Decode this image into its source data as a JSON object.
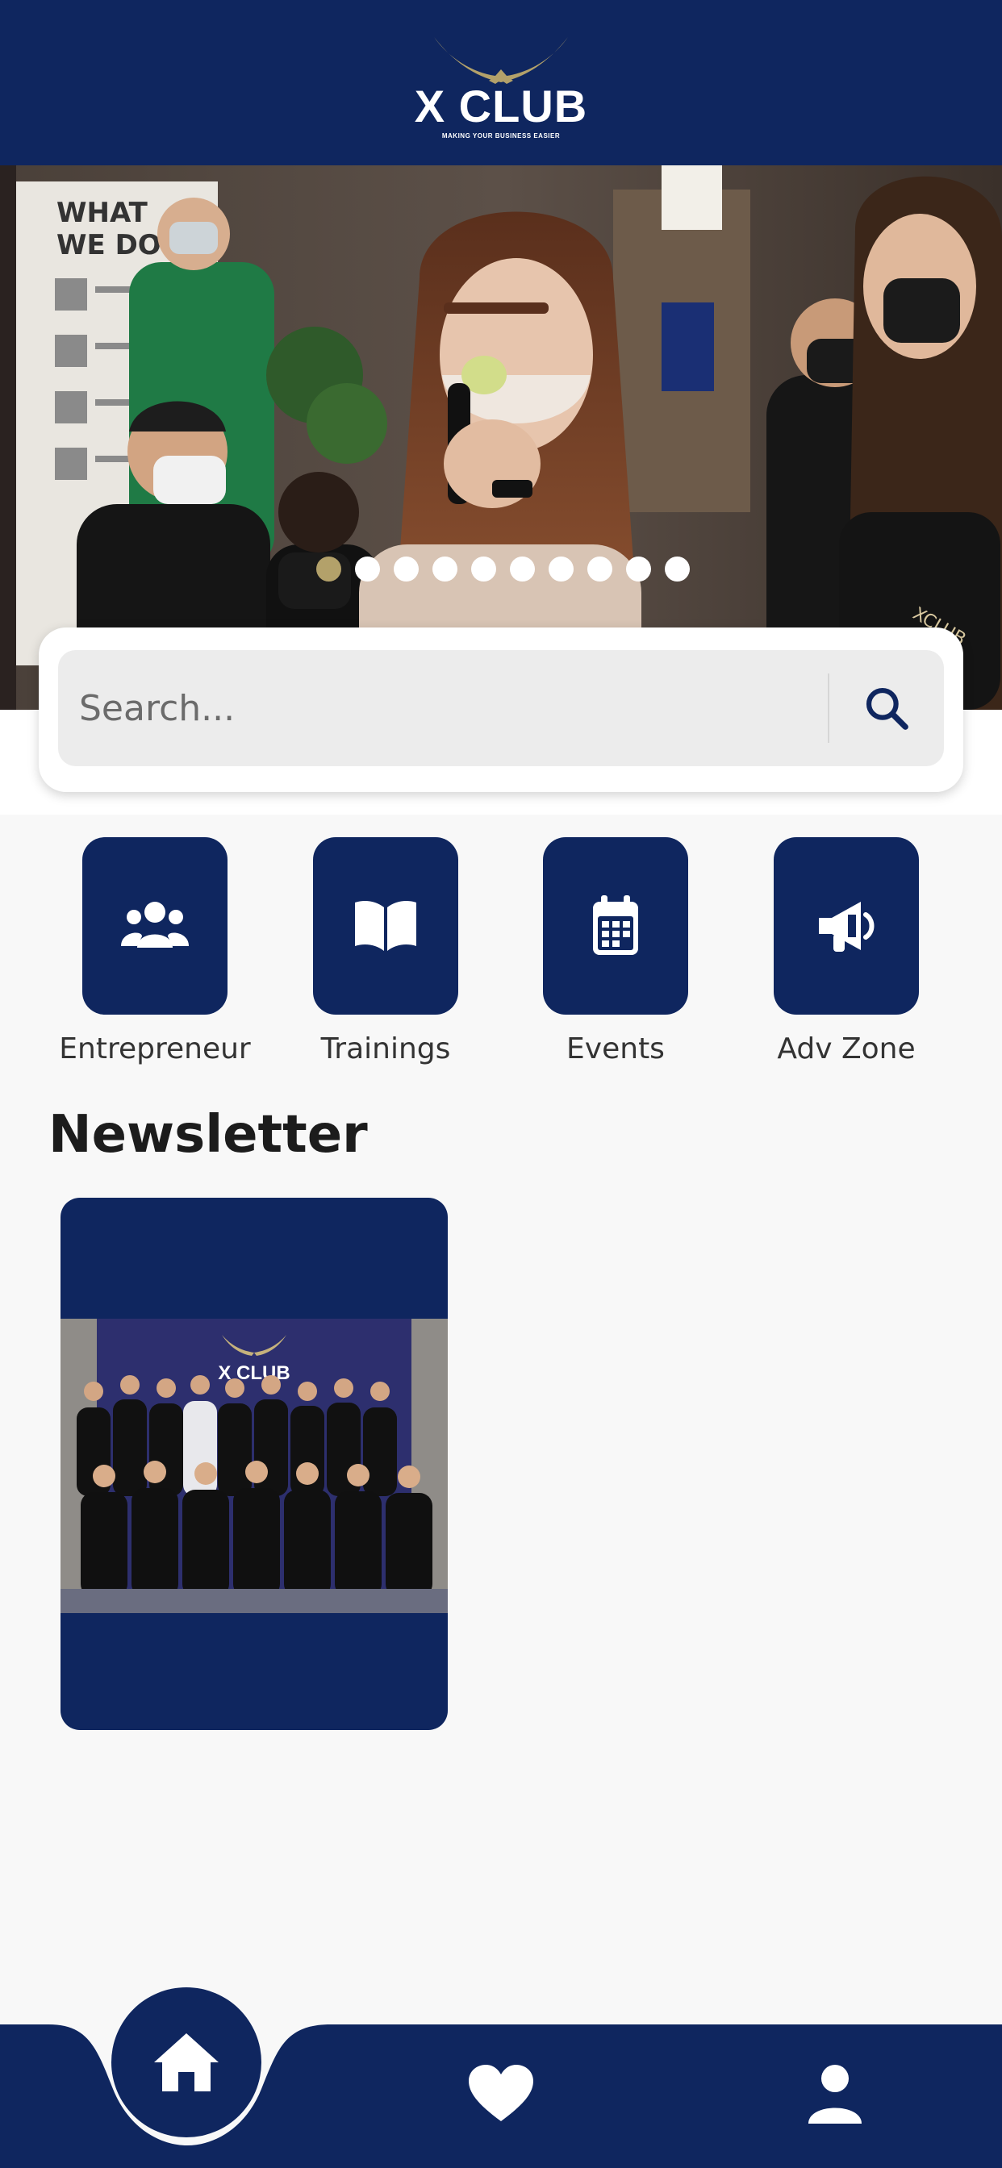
{
  "header": {
    "brand": "X CLUB",
    "tagline": "MAKING YOUR BUSINESS EASIER",
    "logo_icon": "eagle-wings-icon"
  },
  "banner": {
    "slides_count": 10,
    "active_index": 0,
    "wall_text": "WHAT\nWE DO"
  },
  "search": {
    "placeholder": "Search...",
    "icon": "search-icon"
  },
  "categories": [
    {
      "label": "Entrepreneur",
      "icon": "users-icon"
    },
    {
      "label": "Trainings",
      "icon": "book-open-icon"
    },
    {
      "label": "Events",
      "icon": "calendar-icon"
    },
    {
      "label": "Adv Zone",
      "icon": "megaphone-icon"
    }
  ],
  "newsletter": {
    "title": "Newsletter",
    "items": [
      {
        "image_icon": "group-photo-image"
      }
    ]
  },
  "bottom_nav": {
    "items": [
      {
        "icon": "home-icon",
        "active": true
      },
      {
        "icon": "heart-icon",
        "active": false
      },
      {
        "icon": "user-icon",
        "active": false
      }
    ]
  },
  "colors": {
    "primary": "#0f265f",
    "accent_gold": "#b3a16a",
    "background": "#f8f8f8"
  }
}
